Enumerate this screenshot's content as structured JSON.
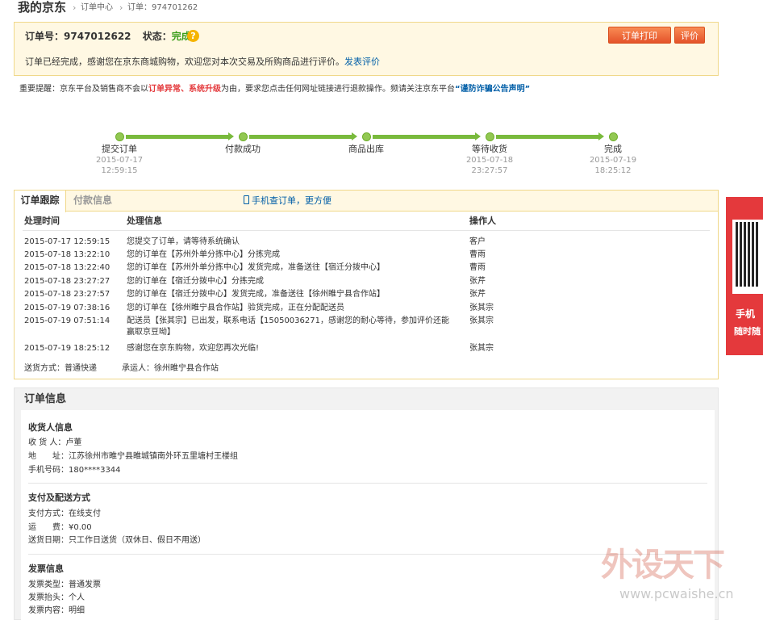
{
  "breadcrumb": {
    "title": "我的京东",
    "items": [
      "订单中心",
      "订单：974701262"
    ],
    "sep": "›"
  },
  "order": {
    "number_label": "订单号：",
    "number": "9747012622",
    "status_label": "状态：",
    "status": "完成",
    "help_icon": "?",
    "print_button": "订单打印",
    "review_button": "评价",
    "message": "订单已经完成，感谢您在京东商城购物，欢迎您对本次交易及所购商品进行评价。",
    "message_link": "发表评价"
  },
  "notice": {
    "prefix": "重要提醒：京东平台及销售商不会以",
    "highlight": "订单异常、系统升级",
    "middle": "为由，要求您点击任何网址链接进行退款操作。频请关注京东平台",
    "link": "“谨防诈骗公告声明”"
  },
  "progress": {
    "steps": [
      {
        "label": "提交订单",
        "date": "2015-07-17",
        "time": "12:59:15"
      },
      {
        "label": "付款成功",
        "date": "",
        "time": ""
      },
      {
        "label": "商品出库",
        "date": "",
        "time": ""
      },
      {
        "label": "等待收货",
        "date": "2015-07-18",
        "time": "23:27:57"
      },
      {
        "label": "完成",
        "date": "2015-07-19",
        "time": "18:25:12"
      }
    ]
  },
  "tracking": {
    "tab_active": "订单跟踪",
    "tab_inactive": "付款信息",
    "mobile_link": "手机查订单，更方便",
    "headers": [
      "处理时间",
      "处理信息",
      "操作人"
    ],
    "rows": [
      {
        "time": "2015-07-17 12:59:15",
        "info": "您提交了订单，请等待系统确认",
        "info2": "",
        "op": "客户"
      },
      {
        "time": "2015-07-18 13:22:10",
        "info": "您的订单在【苏州外单分拣中心】分拣完成",
        "info2": "",
        "op": "曹雨"
      },
      {
        "time": "2015-07-18 13:22:40",
        "info": "您的订单在【苏州外单分拣中心】发货完成，准备送往【宿迁分拨中心】",
        "info2": "",
        "op": "曹雨"
      },
      {
        "time": "2015-07-18 23:27:27",
        "info": "您的订单在【宿迁分拨中心】分拣完成",
        "info2": "",
        "op": "张芹"
      },
      {
        "time": "2015-07-18 23:27:57",
        "info": "您的订单在【宿迁分拨中心】发货完成，准备送往【徐州睢宁县合作站】",
        "info2": "",
        "op": "张芹"
      },
      {
        "time": "2015-07-19 07:38:16",
        "info": "您的订单在【徐州睢宁县合作站】验货完成，正在分配配送员",
        "info2": "",
        "op": "张其宗"
      },
      {
        "time": "2015-07-19 07:51:14",
        "info": "配送员【张其宗】已出发，联系电话【15050036271，感谢您的耐心等待，参加评价还能",
        "info2": "赢取京豆呦】",
        "op": "张其宗"
      },
      {
        "time": "2015-07-19 18:25:12",
        "info": "感谢您在京东购物，欢迎您再次光临!",
        "info2": "",
        "op": "张其宗"
      }
    ],
    "shipping_label": "送货方式：",
    "shipping": "普通快递",
    "carrier_label": "承运人：",
    "carrier": "徐州睢宁县合作站"
  },
  "side": {
    "line1": "手机",
    "line2": "随时随"
  },
  "order_info": {
    "title": "订单信息",
    "receiver_title": "收货人信息",
    "receiver": [
      {
        "k": "收 货 人：",
        "v": "卢董"
      },
      {
        "k": "地　　址：",
        "v": "江苏徐州市睢宁县睢城镇南外环五里塘村王楼组"
      },
      {
        "k": "手机号码：",
        "v": "180****3344"
      }
    ],
    "payment_title": "支付及配送方式",
    "payment": [
      {
        "k": "支付方式：",
        "v": "在线支付"
      },
      {
        "k": "运　　费：",
        "v": "¥0.00"
      },
      {
        "k": "送货日期：",
        "v": "只工作日送货（双休日、假日不用送）"
      }
    ],
    "invoice_title": "发票信息",
    "invoice": [
      {
        "k": "发票类型：",
        "v": "普通发票"
      },
      {
        "k": "发票抬头：",
        "v": "个人"
      },
      {
        "k": "发票内容：",
        "v": "明细"
      }
    ]
  },
  "watermark": {
    "text": "外设天下",
    "url": "www.pcwaishe.cn"
  }
}
